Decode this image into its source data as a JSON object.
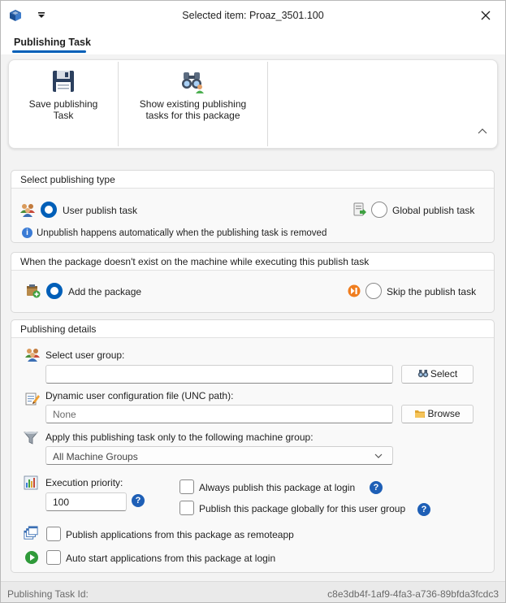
{
  "window": {
    "title": "Selected item: Proaz_3501.100"
  },
  "tab": {
    "label": "Publishing Task"
  },
  "ribbon": {
    "save_label": "Save publishing Task",
    "show_label": "Show existing publishing tasks for this package"
  },
  "publishing_type": {
    "header": "Select publishing type",
    "user_label": "User publish task",
    "global_label": "Global publish task",
    "user_selected": true,
    "info": "Unpublish happens automatically when the publishing task is removed"
  },
  "missing_package": {
    "header": "When the package doesn't exist on the machine while executing this publish task",
    "add_label": "Add the package",
    "skip_label": "Skip the publish task",
    "add_selected": true
  },
  "details": {
    "header": "Publishing details",
    "user_group_label": "Select user group:",
    "user_group_value": "",
    "select_button": "Select",
    "config_label": "Dynamic user configuration file (UNC path):",
    "config_placeholder": "None",
    "browse_button": "Browse",
    "machine_group_label": "Apply this publishing task only to the following machine group:",
    "machine_group_value": "All Machine Groups",
    "priority_label": "Execution priority:",
    "priority_value": "100",
    "always_publish_label": "Always publish this package at login",
    "global_user_label": "Publish this package globally for this user group",
    "remoteapp_label": "Publish applications from this package as remoteapp",
    "autostart_label": "Auto start applications from this package at login",
    "help_glyph": "?"
  },
  "status": {
    "label": "Publishing Task Id:",
    "value": "c8e3db4f-1af9-4fa3-a736-89bfda3fcdc3"
  },
  "colors": {
    "accent": "#005fb8",
    "help": "#1e5fb6"
  }
}
